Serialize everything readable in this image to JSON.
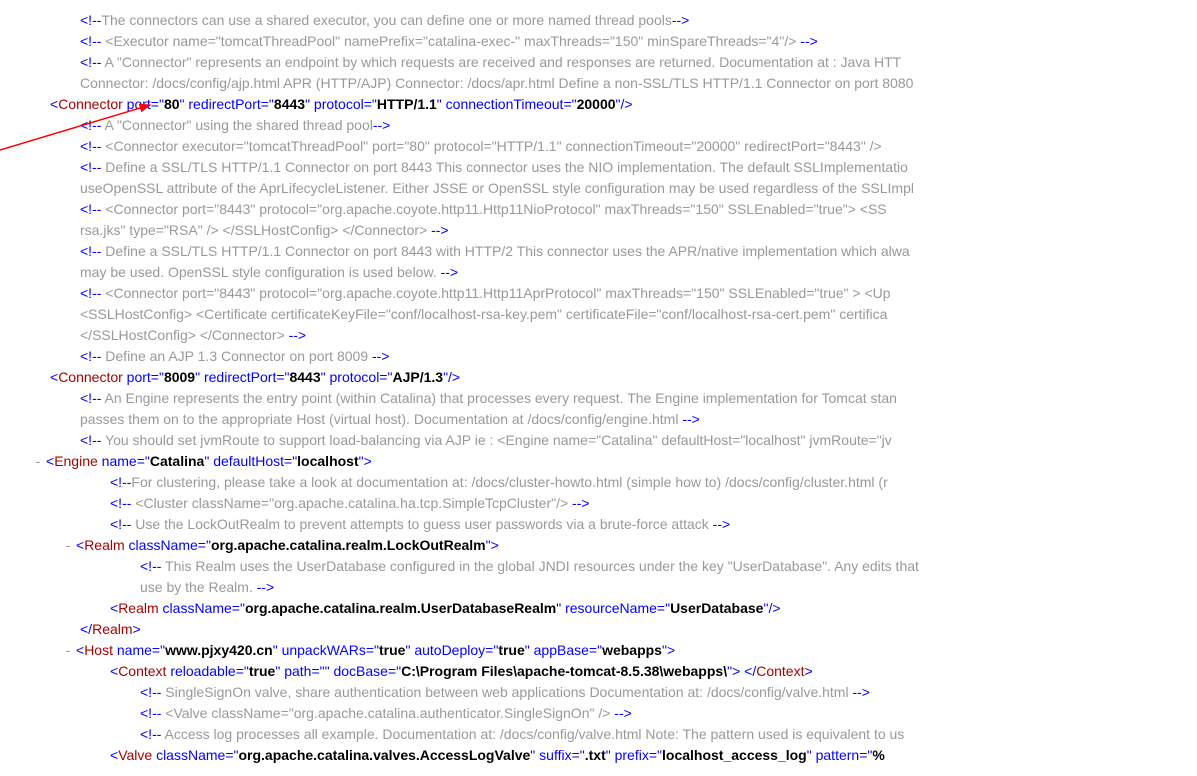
{
  "lines": [
    {
      "cls": "ind2",
      "parts": [
        {
          "t": "brkt",
          "v": "<!--"
        },
        {
          "t": "cmt",
          "v": "The connectors can use a shared executor, you can define one or more named thread pools"
        },
        {
          "t": "brkt",
          "v": "-->"
        }
      ]
    },
    {
      "cls": "ind2",
      "parts": [
        {
          "t": "brkt",
          "v": "<!--"
        },
        {
          "t": "cmt",
          "v": " <Executor name=\"tomcatThreadPool\" namePrefix=\"catalina-exec-\" maxThreads=\"150\" minSpareThreads=\"4\"/> "
        },
        {
          "t": "brkt",
          "v": "-->"
        }
      ]
    },
    {
      "cls": "ind2",
      "parts": [
        {
          "t": "brkt",
          "v": "<!--"
        },
        {
          "t": "cmt",
          "v": " A \"Connector\" represents an endpoint by which requests are received and responses are returned. Documentation at : Java HTT"
        }
      ]
    },
    {
      "cls": "ind2",
      "parts": [
        {
          "t": "cmt",
          "v": "Connector: /docs/config/ajp.html APR (HTTP/AJP) Connector: /docs/apr.html Define a non-SSL/TLS HTTP/1.1 Connector on port 8080"
        }
      ]
    },
    {
      "cls": "ind1",
      "parts": [
        {
          "t": "brkt",
          "v": "<"
        },
        {
          "t": "tag",
          "v": "Connector "
        },
        {
          "t": "attr",
          "v": "port"
        },
        {
          "t": "eq",
          "v": "=\""
        },
        {
          "t": "val",
          "v": "80"
        },
        {
          "t": "eq",
          "v": "\" "
        },
        {
          "t": "attr",
          "v": "redirectPort"
        },
        {
          "t": "eq",
          "v": "=\""
        },
        {
          "t": "val",
          "v": "8443"
        },
        {
          "t": "eq",
          "v": "\" "
        },
        {
          "t": "attr",
          "v": "protocol"
        },
        {
          "t": "eq",
          "v": "=\""
        },
        {
          "t": "val",
          "v": "HTTP/1.1"
        },
        {
          "t": "eq",
          "v": "\" "
        },
        {
          "t": "attr",
          "v": "connectionTimeout"
        },
        {
          "t": "eq",
          "v": "=\""
        },
        {
          "t": "val",
          "v": "20000"
        },
        {
          "t": "eq",
          "v": "\""
        },
        {
          "t": "brkt",
          "v": "/>"
        }
      ]
    },
    {
      "cls": "ind2",
      "parts": [
        {
          "t": "brkt",
          "v": "<!--"
        },
        {
          "t": "cmt",
          "v": " A \"Connector\" using the shared thread pool"
        },
        {
          "t": "brkt",
          "v": "-->"
        }
      ]
    },
    {
      "cls": "ind2",
      "parts": [
        {
          "t": "brkt",
          "v": "<!--"
        },
        {
          "t": "cmt",
          "v": " <Connector executor=\"tomcatThreadPool\" port=\"80\" protocol=\"HTTP/1.1\" connectionTimeout=\"20000\" redirectPort=\"8443\" />"
        }
      ]
    },
    {
      "cls": "ind2",
      "parts": [
        {
          "t": "brkt",
          "v": "<!--"
        },
        {
          "t": "cmt",
          "v": " Define a SSL/TLS HTTP/1.1 Connector on port 8443 This connector uses the NIO implementation. The default SSLImplementatio"
        }
      ]
    },
    {
      "cls": "ind2",
      "parts": [
        {
          "t": "cmt",
          "v": "useOpenSSL attribute of the AprLifecycleListener. Either JSSE or OpenSSL style configuration may be used regardless of the SSLImpl"
        }
      ]
    },
    {
      "cls": "ind2",
      "parts": [
        {
          "t": "brkt",
          "v": "<!--"
        },
        {
          "t": "cmt",
          "v": " <Connector port=\"8443\" protocol=\"org.apache.coyote.http11.Http11NioProtocol\" maxThreads=\"150\" SSLEnabled=\"true\"> <SS"
        }
      ]
    },
    {
      "cls": "ind2",
      "parts": [
        {
          "t": "cmt",
          "v": "rsa.jks\" type=\"RSA\" /> </SSLHostConfig> </Connector> "
        },
        {
          "t": "brkt",
          "v": "-->"
        }
      ]
    },
    {
      "cls": "ind2",
      "parts": [
        {
          "t": "brkt",
          "v": "<!--"
        },
        {
          "t": "cmt",
          "v": " Define a SSL/TLS HTTP/1.1 Connector on port 8443 with HTTP/2 This connector uses the APR/native implementation which alwa"
        }
      ]
    },
    {
      "cls": "ind2",
      "parts": [
        {
          "t": "cmt",
          "v": "may be used. OpenSSL style configuration is used below. "
        },
        {
          "t": "brkt",
          "v": "-->"
        }
      ]
    },
    {
      "cls": "ind2",
      "parts": [
        {
          "t": "brkt",
          "v": "<!--"
        },
        {
          "t": "cmt",
          "v": " <Connector port=\"8443\" protocol=\"org.apache.coyote.http11.Http11AprProtocol\" maxThreads=\"150\" SSLEnabled=\"true\" > <Up"
        }
      ]
    },
    {
      "cls": "ind2",
      "parts": [
        {
          "t": "cmt",
          "v": "<SSLHostConfig> <Certificate certificateKeyFile=\"conf/localhost-rsa-key.pem\" certificateFile=\"conf/localhost-rsa-cert.pem\" certifica"
        }
      ]
    },
    {
      "cls": "ind2",
      "parts": [
        {
          "t": "cmt",
          "v": "</SSLHostConfig> </Connector> "
        },
        {
          "t": "brkt",
          "v": "-->"
        }
      ]
    },
    {
      "cls": "ind2",
      "parts": [
        {
          "t": "brkt",
          "v": "<!--"
        },
        {
          "t": "cmt",
          "v": " Define an AJP 1.3 Connector on port 8009 "
        },
        {
          "t": "brkt",
          "v": "-->"
        }
      ]
    },
    {
      "cls": "ind1",
      "parts": [
        {
          "t": "brkt",
          "v": "<"
        },
        {
          "t": "tag",
          "v": "Connector "
        },
        {
          "t": "attr",
          "v": "port"
        },
        {
          "t": "eq",
          "v": "=\""
        },
        {
          "t": "val",
          "v": "8009"
        },
        {
          "t": "eq",
          "v": "\" "
        },
        {
          "t": "attr",
          "v": "redirectPort"
        },
        {
          "t": "eq",
          "v": "=\""
        },
        {
          "t": "val",
          "v": "8443"
        },
        {
          "t": "eq",
          "v": "\" "
        },
        {
          "t": "attr",
          "v": "protocol"
        },
        {
          "t": "eq",
          "v": "=\""
        },
        {
          "t": "val",
          "v": "AJP/1.3"
        },
        {
          "t": "eq",
          "v": "\""
        },
        {
          "t": "brkt",
          "v": "/>"
        }
      ]
    },
    {
      "cls": "ind2",
      "parts": [
        {
          "t": "brkt",
          "v": "<!--"
        },
        {
          "t": "cmt",
          "v": " An Engine represents the entry point (within Catalina) that processes every request. The Engine implementation for Tomcat stan"
        }
      ]
    },
    {
      "cls": "ind2",
      "parts": [
        {
          "t": "cmt",
          "v": "passes them on to the appropriate Host (virtual host). Documentation at /docs/config/engine.html "
        },
        {
          "t": "brkt",
          "v": "-->"
        }
      ]
    },
    {
      "cls": "ind2",
      "parts": [
        {
          "t": "brkt",
          "v": "<!--"
        },
        {
          "t": "cmt",
          "v": " You should set jvmRoute to support load-balancing via AJP ie : <Engine name=\"Catalina\" defaultHost=\"localhost\" jvmRoute=\"jv"
        }
      ]
    },
    {
      "cls": "ind1",
      "tog": "-",
      "parts": [
        {
          "t": "brkt",
          "v": "<"
        },
        {
          "t": "tag",
          "v": "Engine "
        },
        {
          "t": "attr",
          "v": "name"
        },
        {
          "t": "eq",
          "v": "=\""
        },
        {
          "t": "val",
          "v": "Catalina"
        },
        {
          "t": "eq",
          "v": "\" "
        },
        {
          "t": "attr",
          "v": "defaultHost"
        },
        {
          "t": "eq",
          "v": "=\""
        },
        {
          "t": "val",
          "v": "localhost"
        },
        {
          "t": "eq",
          "v": "\""
        },
        {
          "t": "brkt",
          "v": ">"
        }
      ]
    },
    {
      "cls": "ind3",
      "parts": [
        {
          "t": "brkt",
          "v": "<!--"
        },
        {
          "t": "cmt",
          "v": "For clustering, please take a look at documentation at: /docs/cluster-howto.html (simple how to) /docs/config/cluster.html (r"
        }
      ]
    },
    {
      "cls": "ind3",
      "parts": [
        {
          "t": "brkt",
          "v": "<!--"
        },
        {
          "t": "cmt",
          "v": " <Cluster className=\"org.apache.catalina.ha.tcp.SimpleTcpCluster\"/> "
        },
        {
          "t": "brkt",
          "v": "-->"
        }
      ]
    },
    {
      "cls": "ind3",
      "parts": [
        {
          "t": "brkt",
          "v": "<!--"
        },
        {
          "t": "cmt",
          "v": " Use the LockOutRealm to prevent attempts to guess user passwords via a brute-force attack "
        },
        {
          "t": "brkt",
          "v": "-->"
        }
      ]
    },
    {
      "cls": "ind2",
      "tog": "-",
      "parts": [
        {
          "t": "brkt",
          "v": "<"
        },
        {
          "t": "tag",
          "v": "Realm "
        },
        {
          "t": "attr",
          "v": "className"
        },
        {
          "t": "eq",
          "v": "=\""
        },
        {
          "t": "val",
          "v": "org.apache.catalina.realm.LockOutRealm"
        },
        {
          "t": "eq",
          "v": "\""
        },
        {
          "t": "brkt",
          "v": ">"
        }
      ]
    },
    {
      "cls": "ind4",
      "parts": [
        {
          "t": "brkt",
          "v": "<!--"
        },
        {
          "t": "cmt",
          "v": " This Realm uses the UserDatabase configured in the global JNDI resources under the key \"UserDatabase\". Any edits that"
        }
      ]
    },
    {
      "cls": "ind4",
      "parts": [
        {
          "t": "cmt",
          "v": "use by the Realm. "
        },
        {
          "t": "brkt",
          "v": "-->"
        }
      ]
    },
    {
      "cls": "ind3",
      "parts": [
        {
          "t": "brkt",
          "v": "<"
        },
        {
          "t": "tag",
          "v": "Realm "
        },
        {
          "t": "attr",
          "v": "className"
        },
        {
          "t": "eq",
          "v": "=\""
        },
        {
          "t": "val",
          "v": "org.apache.catalina.realm.UserDatabaseRealm"
        },
        {
          "t": "eq",
          "v": "\" "
        },
        {
          "t": "attr",
          "v": "resourceName"
        },
        {
          "t": "eq",
          "v": "=\""
        },
        {
          "t": "val",
          "v": "UserDatabase"
        },
        {
          "t": "eq",
          "v": "\""
        },
        {
          "t": "brkt",
          "v": "/>"
        }
      ]
    },
    {
      "cls": "ind2",
      "parts": [
        {
          "t": "brkt",
          "v": "</"
        },
        {
          "t": "tag",
          "v": "Realm"
        },
        {
          "t": "brkt",
          "v": ">"
        }
      ]
    },
    {
      "cls": "ind2",
      "tog": "-",
      "parts": [
        {
          "t": "brkt",
          "v": "<"
        },
        {
          "t": "tag",
          "v": "Host "
        },
        {
          "t": "attr",
          "v": "name"
        },
        {
          "t": "eq",
          "v": "=\""
        },
        {
          "t": "val",
          "v": "www.pjxy420.cn"
        },
        {
          "t": "eq",
          "v": "\" "
        },
        {
          "t": "attr",
          "v": "unpackWARs"
        },
        {
          "t": "eq",
          "v": "=\""
        },
        {
          "t": "val",
          "v": "true"
        },
        {
          "t": "eq",
          "v": "\" "
        },
        {
          "t": "attr",
          "v": "autoDeploy"
        },
        {
          "t": "eq",
          "v": "=\""
        },
        {
          "t": "val",
          "v": "true"
        },
        {
          "t": "eq",
          "v": "\" "
        },
        {
          "t": "attr",
          "v": "appBase"
        },
        {
          "t": "eq",
          "v": "=\""
        },
        {
          "t": "val",
          "v": "webapps"
        },
        {
          "t": "eq",
          "v": "\""
        },
        {
          "t": "brkt",
          "v": ">"
        }
      ]
    },
    {
      "cls": "ind3",
      "parts": [
        {
          "t": "brkt",
          "v": "<"
        },
        {
          "t": "tag",
          "v": "Context "
        },
        {
          "t": "attr",
          "v": "reloadable"
        },
        {
          "t": "eq",
          "v": "=\""
        },
        {
          "t": "val",
          "v": "true"
        },
        {
          "t": "eq",
          "v": "\" "
        },
        {
          "t": "attr",
          "v": "path"
        },
        {
          "t": "eq",
          "v": "=\"\" "
        },
        {
          "t": "attr",
          "v": "docBase"
        },
        {
          "t": "eq",
          "v": "=\""
        },
        {
          "t": "val",
          "v": "C:\\Program Files\\apache-tomcat-8.5.38\\webapps\\"
        },
        {
          "t": "eq",
          "v": "\""
        },
        {
          "t": "brkt",
          "v": "> </"
        },
        {
          "t": "tag",
          "v": "Context"
        },
        {
          "t": "brkt",
          "v": ">"
        }
      ]
    },
    {
      "cls": "ind4",
      "parts": [
        {
          "t": "brkt",
          "v": "<!--"
        },
        {
          "t": "cmt",
          "v": " SingleSignOn valve, share authentication between web applications Documentation at: /docs/config/valve.html "
        },
        {
          "t": "brkt",
          "v": "-->"
        }
      ]
    },
    {
      "cls": "ind4",
      "parts": [
        {
          "t": "brkt",
          "v": "<!--"
        },
        {
          "t": "cmt",
          "v": " <Valve className=\"org.apache.catalina.authenticator.SingleSignOn\" /> "
        },
        {
          "t": "brkt",
          "v": "-->"
        }
      ]
    },
    {
      "cls": "ind4",
      "parts": [
        {
          "t": "brkt",
          "v": "<!--"
        },
        {
          "t": "cmt",
          "v": " Access log processes all example. Documentation at: /docs/config/valve.html Note: The pattern used is equivalent to us"
        }
      ]
    },
    {
      "cls": "ind3",
      "parts": [
        {
          "t": "brkt",
          "v": "<"
        },
        {
          "t": "tag",
          "v": "Valve "
        },
        {
          "t": "attr",
          "v": "className"
        },
        {
          "t": "eq",
          "v": "=\""
        },
        {
          "t": "val",
          "v": "org.apache.catalina.valves.AccessLogValve"
        },
        {
          "t": "eq",
          "v": "\" "
        },
        {
          "t": "attr",
          "v": "suffix"
        },
        {
          "t": "eq",
          "v": "=\""
        },
        {
          "t": "val",
          "v": ".txt"
        },
        {
          "t": "eq",
          "v": "\" "
        },
        {
          "t": "attr",
          "v": "prefix"
        },
        {
          "t": "eq",
          "v": "=\""
        },
        {
          "t": "val",
          "v": "localhost_access_log"
        },
        {
          "t": "eq",
          "v": "\" "
        },
        {
          "t": "attr",
          "v": "pattern"
        },
        {
          "t": "eq",
          "v": "=\""
        },
        {
          "t": "val",
          "v": "%"
        }
      ]
    }
  ]
}
